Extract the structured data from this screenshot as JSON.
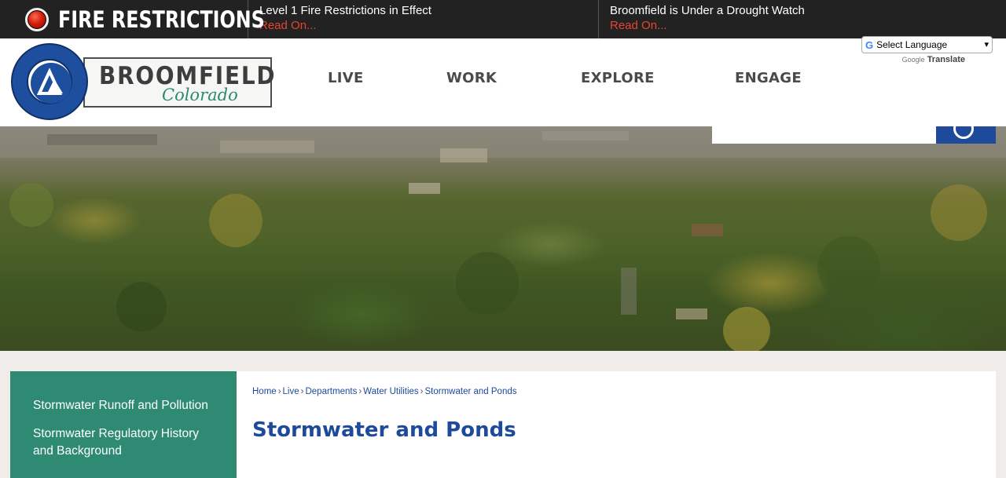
{
  "alert_bar": {
    "brand_title": "FIRE RESTRICTIONS",
    "alerts": [
      {
        "headline": "Level 1 Fire Restrictions in Effect",
        "link": "Read On..."
      },
      {
        "headline": "Broomfield is Under a Drought Watch",
        "link": "Read On..."
      }
    ]
  },
  "header": {
    "logo_name": "BROOMFIELD",
    "logo_state": "Colorado",
    "nav": [
      "LIVE",
      "WORK",
      "EXPLORE",
      "ENGAGE"
    ],
    "translate": {
      "g_letter": "G",
      "select_label": "Select Language",
      "caret": "▾",
      "powered_by": "Google",
      "translate_word": "Translate"
    }
  },
  "sidebar": {
    "items": [
      "Stormwater Runoff and Pollution",
      "Stormwater Regulatory History and Background"
    ]
  },
  "main": {
    "breadcrumb": [
      "Home",
      "Live",
      "Departments",
      "Water Utilities",
      "Stormwater and Ponds"
    ],
    "separator": "›",
    "title": "Stormwater and Ponds"
  },
  "colors": {
    "alert_bg": "#222222",
    "alert_link": "#e8452c",
    "brand_blue": "#1d4a9a",
    "sidebar_green": "#2e8a73",
    "nav_text": "#4a4a4a"
  },
  "icons": {
    "alert": "red-alert-dot-icon",
    "search": "search-icon"
  }
}
